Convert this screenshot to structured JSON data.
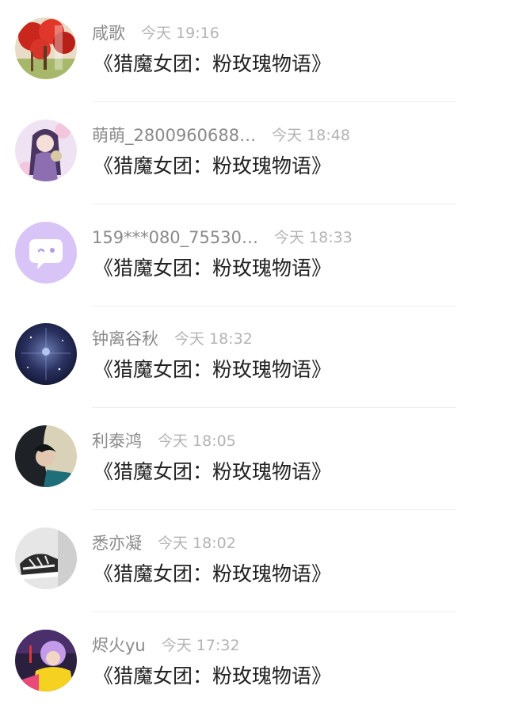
{
  "feed": {
    "items": [
      {
        "name": "咸歌",
        "time": "今天 19:16",
        "title": "《猎魔女团：粉玫瑰物语》",
        "avatar": "red-tree-artwork-avatar"
      },
      {
        "name": "萌萌_2800960688…",
        "time": "今天 18:48",
        "title": "《猎魔女团：粉玫瑰物语》",
        "avatar": "anime-girl-purple-avatar"
      },
      {
        "name": "159***080_75530…",
        "time": "今天 18:33",
        "title": "《猎魔女团：粉玫瑰物语》",
        "avatar": "chat-bubble-default-avatar"
      },
      {
        "name": "钟离谷秋",
        "time": "今天 18:32",
        "title": "《猎魔女团：粉玫瑰物语》",
        "avatar": "starry-space-avatar"
      },
      {
        "name": "利泰鸿",
        "time": "今天 18:05",
        "title": "《猎魔女团：粉玫瑰物语》",
        "avatar": "woman-portrait-avatar"
      },
      {
        "name": "悉亦凝",
        "time": "今天 18:02",
        "title": "《猎魔女团：粉玫瑰物语》",
        "avatar": "bw-sneakers-avatar"
      },
      {
        "name": "烬火yu",
        "time": "今天 17:32",
        "title": "《猎魔女团：粉玫瑰物语》",
        "avatar": "purple-hair-singer-avatar"
      }
    ]
  },
  "colors": {
    "name": "#8a8a8a",
    "time": "#b4b4b4",
    "title": "#222222",
    "divider": "#efefef",
    "default_avatar_bg": "#d9c4f7"
  }
}
